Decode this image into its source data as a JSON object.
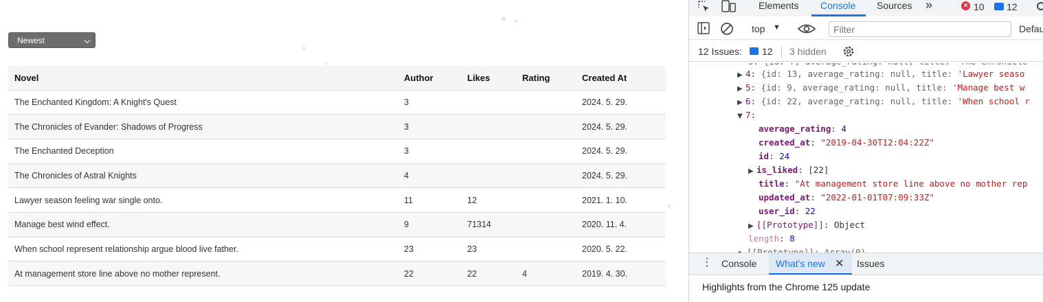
{
  "sort": {
    "selected": "Newest"
  },
  "table": {
    "headers": {
      "novel": "Novel",
      "author": "Author",
      "likes": "Likes",
      "rating": "Rating",
      "created": "Created At"
    },
    "rows": [
      {
        "novel": "The Enchanted Kingdom: A Knight's Quest",
        "author": "3",
        "likes": "",
        "rating": "",
        "created": "2024. 5. 29."
      },
      {
        "novel": "The Chronicles of Evander: Shadows of Progress",
        "author": "3",
        "likes": "",
        "rating": "",
        "created": "2024. 5. 29."
      },
      {
        "novel": "The Enchanted Deception",
        "author": "3",
        "likes": "",
        "rating": "",
        "created": "2024. 5. 29."
      },
      {
        "novel": "The Chronicles of Astral Knights",
        "author": "4",
        "likes": "",
        "rating": "",
        "created": "2024. 5. 29."
      },
      {
        "novel": "Lawyer season feeling war single onto.",
        "author": "11",
        "likes": "12",
        "rating": "",
        "created": "2021. 1. 10."
      },
      {
        "novel": "Manage best wind effect.",
        "author": "9",
        "likes": "71314",
        "rating": "",
        "created": "2020. 11. 4."
      },
      {
        "novel": "When school represent relationship argue blood live father.",
        "author": "23",
        "likes": "23",
        "rating": "",
        "created": "2020. 5. 22."
      },
      {
        "novel": "At management store line above no mother represent.",
        "author": "22",
        "likes": "22",
        "rating": "4",
        "created": "2019. 4. 30."
      }
    ]
  },
  "devtools": {
    "tabs": {
      "elements": "Elements",
      "console": "Console",
      "sources": "Sources",
      "more": "»"
    },
    "error_count": "10",
    "message_count": "12",
    "toolbar": {
      "context": "top",
      "filter_placeholder": "Filter",
      "levels": "Defau"
    },
    "issues": {
      "label": "12 Issues:",
      "count": "12",
      "hidden": "3 hidden"
    },
    "console": {
      "top_partial": "3: {id: 7, average_rating: null, title: 'The Chronicle",
      "row4": {
        "idx": "4:",
        "body": "{id: 13, average_rating: null, title: ",
        "title": "'Lawyer seaso"
      },
      "row5": {
        "idx": "5:",
        "body": "{id: 9, average_rating: null, title: ",
        "title": "'Manage best w"
      },
      "row6": {
        "idx": "6:",
        "body": "{id: 22, average_rating: null, title: ",
        "title": "'When school r"
      },
      "row7": {
        "idx": "7:"
      },
      "avg_key": "average_rating",
      "avg_val": "4",
      "created_key": "created_at",
      "created_val": "\"2019-04-30T12:04:22Z\"",
      "id_key": "id",
      "id_val": "24",
      "liked_key": "is_liked",
      "liked_val": "[22]",
      "title_key": "title",
      "title_val": "\"At management store line above no mother rep",
      "updated_key": "updated_at",
      "updated_val": "\"2022-01-01T07:09:33Z\"",
      "userid_key": "user_id",
      "userid_val": "22",
      "proto_key": "[[Prototype]]",
      "proto_val": "Object",
      "length_key": "length",
      "length_val": "8",
      "bottom_partial": "[[Prototype]]: Array(0)"
    },
    "drawer": {
      "console": "Console",
      "whats_new": "What's new",
      "issues": "Issues",
      "headline": "Highlights from the Chrome 125 update"
    }
  }
}
